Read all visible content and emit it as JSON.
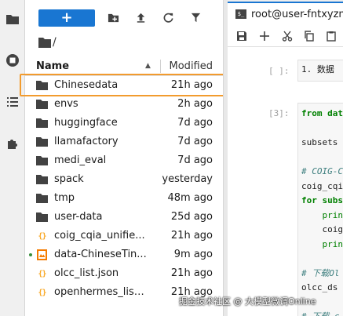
{
  "toolbar": {
    "new_label": "+"
  },
  "breadcrumb": {
    "separator": "/"
  },
  "file_list": {
    "columns": {
      "name": "Name",
      "modified": "Modified"
    },
    "rows": [
      {
        "name": "Chinesedata",
        "modified": "21h ago",
        "type": "folder",
        "running": false
      },
      {
        "name": "envs",
        "modified": "2h ago",
        "type": "folder",
        "running": false
      },
      {
        "name": "huggingface",
        "modified": "7d ago",
        "type": "folder",
        "running": false
      },
      {
        "name": "llamafactory",
        "modified": "7d ago",
        "type": "folder",
        "running": false
      },
      {
        "name": "medi_eval",
        "modified": "7d ago",
        "type": "folder",
        "running": false
      },
      {
        "name": "spack",
        "modified": "yesterday",
        "type": "folder",
        "running": false
      },
      {
        "name": "tmp",
        "modified": "48m ago",
        "type": "folder",
        "running": false
      },
      {
        "name": "user-data",
        "modified": "25d ago",
        "type": "folder",
        "running": false
      },
      {
        "name": "coig_cqia_unifie...",
        "modified": "21h ago",
        "type": "json",
        "running": false
      },
      {
        "name": "data-ChineseTin...",
        "modified": "9m ago",
        "type": "notebook",
        "running": true
      },
      {
        "name": "olcc_list.json",
        "modified": "21h ago",
        "type": "json",
        "running": false
      },
      {
        "name": "openhermes_list....",
        "modified": "21h ago",
        "type": "json",
        "running": false
      }
    ]
  },
  "notebook": {
    "tab_title": "root@user-fntxyzm",
    "cells": [
      {
        "prompt": "[ ]:",
        "lines": [
          "1. 数据"
        ]
      },
      {
        "prompt": "[3]:",
        "lines": [
          "from dat",
          "",
          "subsets",
          "",
          "# COIG-C",
          "coig_cqia",
          "for subs",
          "    prin",
          "    coig",
          "    prin",
          "",
          "# 下载Ol",
          "olcc_ds",
          "",
          "# 下载 c"
        ]
      }
    ]
  },
  "watermark": "掘金技术社区 @ 大模型微调Online",
  "colors": {
    "accent": "#1976d2",
    "highlight": "#f29b2e",
    "folder": "#424242",
    "json": "#f9a825",
    "notebook": "#f57c00",
    "running_dot": "#388e3c"
  }
}
